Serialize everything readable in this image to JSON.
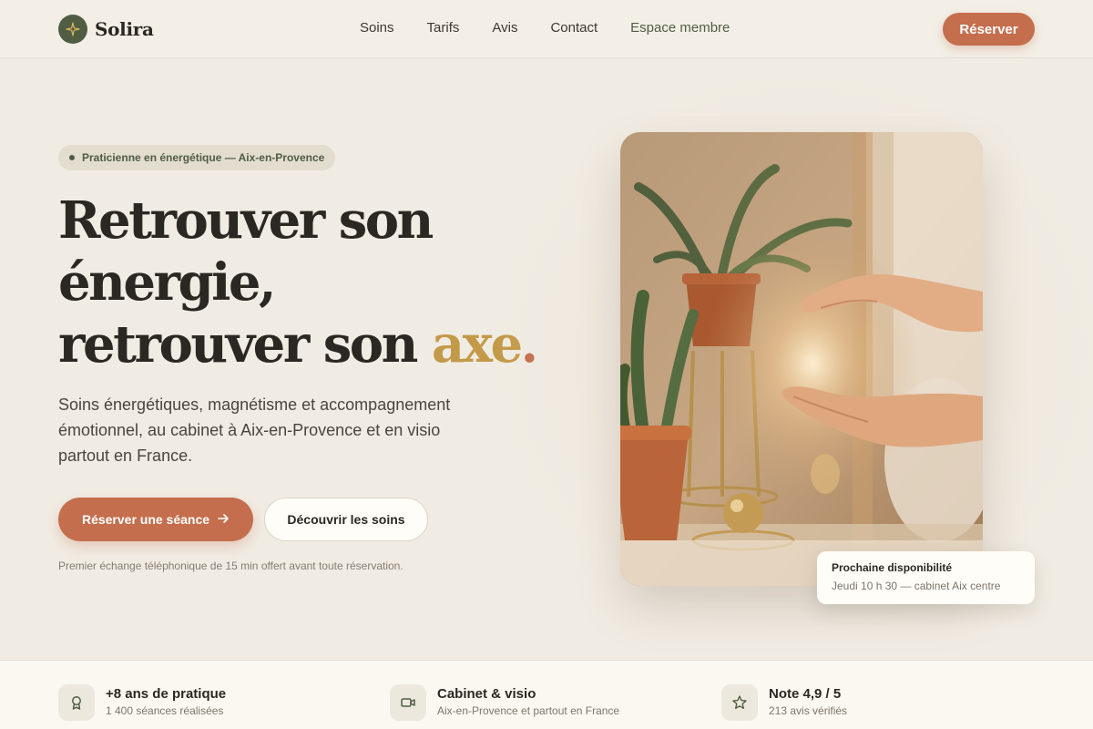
{
  "brand": {
    "name": "Solira",
    "logo_icon": "sparkle-icon"
  },
  "nav": {
    "links": [
      "Soins",
      "Tarifs",
      "Avis",
      "Contact",
      "Espace membre"
    ],
    "cta": "Réserver"
  },
  "hero": {
    "badge": "Praticienne en énergétique — Aix-en-Provence",
    "headline_line1": "Retrouver son",
    "headline_line2": "énergie,",
    "headline_line3": "retrouver son",
    "headline_accent": "axe",
    "headline_dot": ".",
    "subtitle": "Soins énergétiques, magnétisme et accompagnement émotionnel, au cabinet à Aix-en-Provence et en visio partout en France.",
    "primary_cta": "Réserver une séance",
    "secondary_cta": "Découvrir les soins",
    "note": "Premier échange téléphonique de 15 min offert avant toute réservation."
  },
  "availability": {
    "title": "Prochaine disponibilité",
    "detail": "Jeudi 10 h 30 — cabinet Aix centre"
  },
  "stats": [
    {
      "icon": "award-icon",
      "title": "+8 ans de pratique",
      "sub": "1 400 séances réalisées"
    },
    {
      "icon": "video-icon",
      "title": "Cabinet & visio",
      "sub": "Aix-en-Provence et partout en France"
    },
    {
      "icon": "star-icon",
      "title": "Note 4,9 / 5",
      "sub": "213 avis vérifiés"
    }
  ],
  "colors": {
    "background": "#f1ece3",
    "accent": "#c46e4d",
    "olive": "#4f5d43",
    "gold": "#c39a4a"
  }
}
